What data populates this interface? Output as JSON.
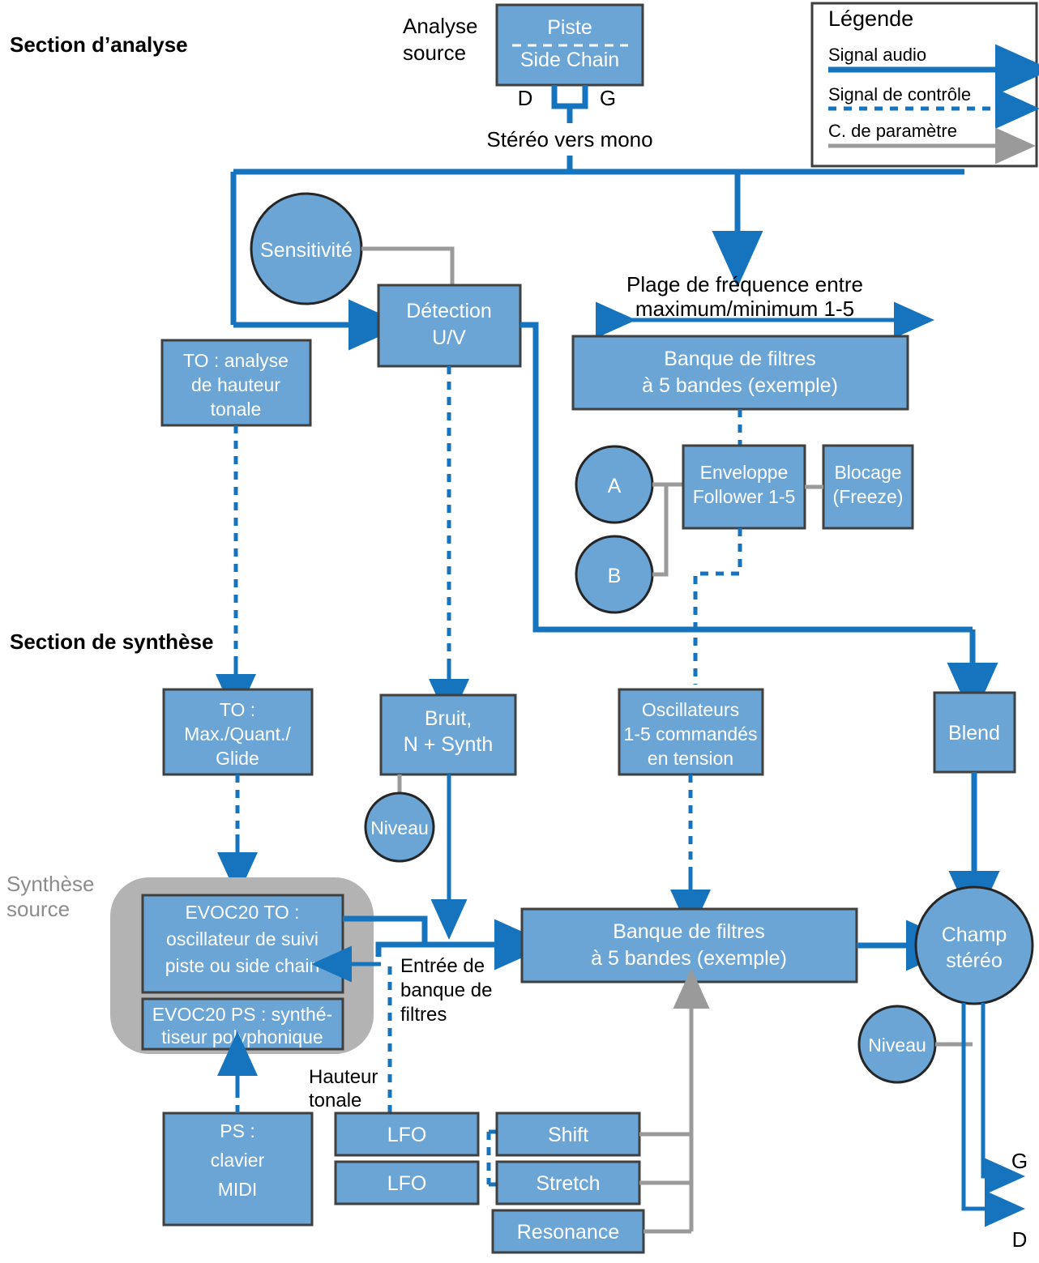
{
  "sections": {
    "analysis_heading": "Section d’analyse",
    "synthesis_heading": "Section de synthèse"
  },
  "labels": {
    "analyse_source_l1": "Analyse",
    "analyse_source_l2": "source",
    "synthese_source_l1": "Synthèse",
    "synthese_source_l2": "source",
    "stereo_vers_mono": "Stéréo vers mono",
    "d_left": "D",
    "g_right": "G",
    "plage_l1": "Plage de fréquence entre",
    "plage_l2": "maximum/minimum 1-5",
    "entree_l1": "Entrée de",
    "entree_l2": "banque de",
    "entree_l3": "filtres",
    "hauteur_l1": "Hauteur",
    "hauteur_l2": "tonale",
    "out_g": "G",
    "out_d": "D"
  },
  "nodes": {
    "piste_l1": "Piste",
    "piste_l2": "Side Chain",
    "sensitivite": "Sensitivité",
    "detection_l1": "Détection",
    "detection_l2": "U/V",
    "to_analyse_l1": "TO : analyse",
    "to_analyse_l2": "de hauteur",
    "to_analyse_l3": "tonale",
    "filterbank_top_l1": "Banque de filtres",
    "filterbank_top_l2": "à 5 bandes (exemple)",
    "circle_a": "A",
    "circle_b": "B",
    "envelope_l1": "Enveloppe",
    "envelope_l2": "Follower 1-5",
    "blocage_l1": "Blocage",
    "blocage_l2": "(Freeze)",
    "to_max_l1": "TO :",
    "to_max_l2": "Max./Quant./",
    "to_max_l3": "Glide",
    "bruit_l1": "Bruit,",
    "bruit_l2": "N + Synth",
    "niveau_bruit": "Niveau",
    "oscillateurs_l1": "Oscillateurs",
    "oscillateurs_l2": "1-5 commandés",
    "oscillateurs_l3": "en tension",
    "blend": "Blend",
    "evoc_to_l1": "EVOC20 TO :",
    "evoc_to_l2": "oscillateur de suivi",
    "evoc_to_l3": "piste ou side chain",
    "evoc_ps_l1": "EVOC20 PS : synthé-",
    "evoc_ps_l2": "tiseur polyphonique",
    "filterbank_bottom_l1": "Banque de filtres",
    "filterbank_bottom_l2": "à 5 bandes (exemple)",
    "champ_l1": "Champ",
    "champ_l2": "stéréo",
    "niveau_champ": "Niveau",
    "ps_clavier_l1": "PS :",
    "ps_clavier_l2": "clavier",
    "ps_clavier_l3": "MIDI",
    "lfo_1": "LFO",
    "lfo_2": "LFO",
    "shift": "Shift",
    "stretch": "Stretch",
    "resonance": "Resonance"
  },
  "legend": {
    "title": "Légende",
    "item_audio": "Signal audio",
    "item_control": "Signal de contrôle",
    "item_parameter": "C. de paramètre"
  },
  "colors": {
    "node_fill": "#6aa5d6",
    "node_stroke": "#404040",
    "audio_signal": "#1574bd",
    "control_signal": "#1574bd",
    "parameter_signal": "#9a9a9a",
    "group_panel": "#b3b3b3",
    "background": "#ffffff",
    "text_on_node": "#ffffff",
    "text_plain": "#000000",
    "gray_heading": "#8c8c8c"
  }
}
